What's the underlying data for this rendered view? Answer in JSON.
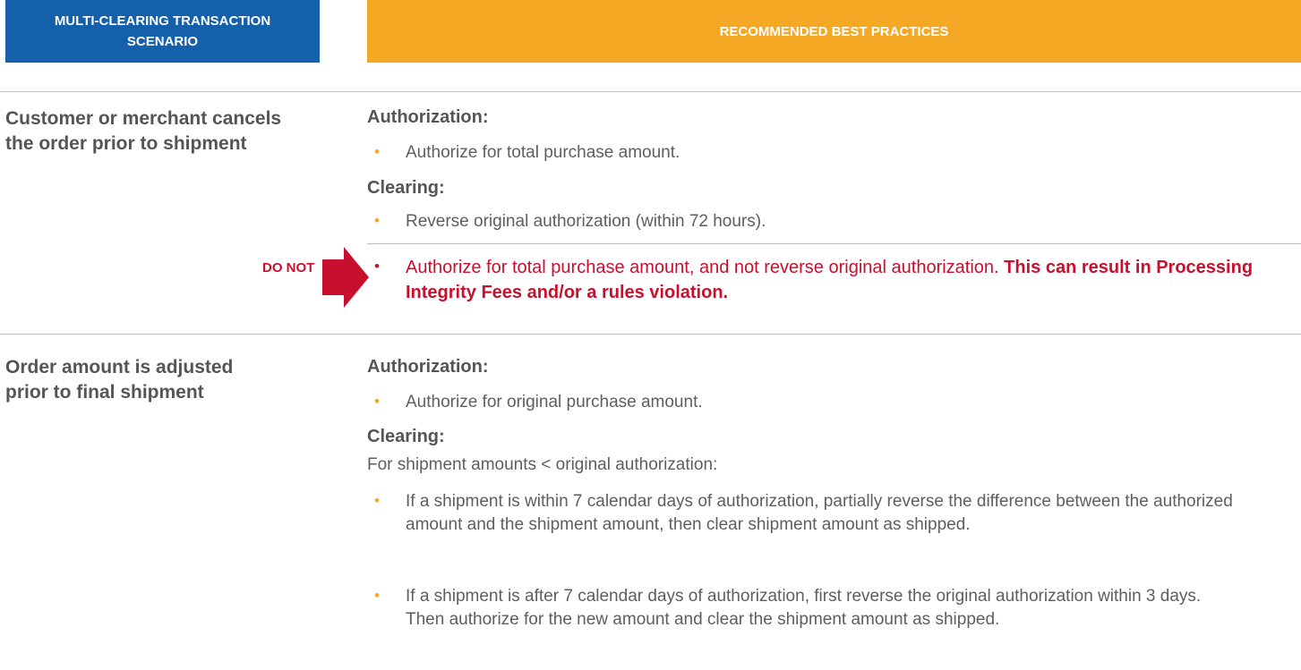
{
  "header": {
    "left": "MULTI-CLEARING TRANSACTION SCENARIO",
    "right": "RECOMMENDED BEST PRACTICES"
  },
  "rows": [
    {
      "scenario": "Customer or merchant cancels the order prior to shipment",
      "authorization_label": "Authorization:",
      "authorization_items": [
        "Authorize for total purchase amount."
      ],
      "clearing_label": "Clearing:",
      "clearing_items": [
        "Reverse original authorization (within 72 hours)."
      ],
      "do_not": {
        "label": "DO NOT",
        "text": "Authorize for total purchase amount, and not reverse original authorization.",
        "emphasis": "This can result in Processing Integrity Fees and/or a rules violation."
      }
    },
    {
      "scenario": "Order amount is adjusted prior to final shipment",
      "authorization_label": "Authorization:",
      "authorization_items": [
        "Authorize for original purchase amount."
      ],
      "clearing_label": "Clearing:",
      "clearing_intro": "For shipment amounts < original authorization:",
      "clearing_items": [
        "If a shipment is within 7 calendar days of authorization, partially reverse the difference between the authorized amount and the shipment amount, then clear shipment amount as shipped.",
        "If a shipment is after 7 calendar days of authorization, first reverse the original authorization within 3 days. Then authorize for the new amount and clear the shipment amount as shipped."
      ]
    }
  ],
  "colors": {
    "header_blue": "#1460ab",
    "header_orange": "#f4a823",
    "warning_red": "#c8102e",
    "text_gray": "#5e5e5e",
    "rule_gray": "#bdbdbd"
  }
}
